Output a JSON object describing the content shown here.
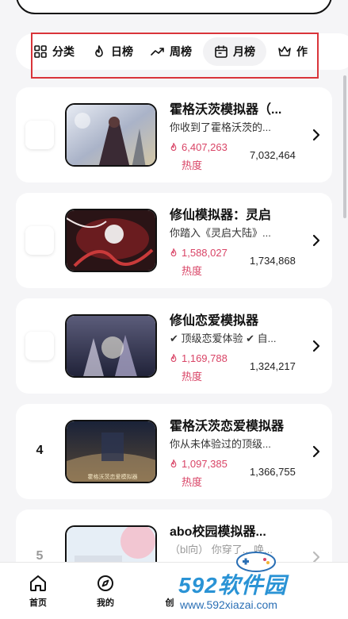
{
  "tabs": [
    {
      "label": "分类",
      "icon": "grid-icon"
    },
    {
      "label": "日榜",
      "icon": "flame-icon"
    },
    {
      "label": "周榜",
      "icon": "trend-icon"
    },
    {
      "label": "月榜",
      "icon": "calendar-icon",
      "active": true
    },
    {
      "label": "作",
      "icon": "crown-icon"
    }
  ],
  "heat_label": "热度",
  "items": [
    {
      "rank": "",
      "title": "霍格沃茨模拟器（...",
      "desc": "你收到了霍格沃茨的...",
      "heat": "6,407,263",
      "count": "7,032,464"
    },
    {
      "rank": "",
      "title": "修仙模拟器：灵启",
      "desc": "你踏入《灵启大陆》...",
      "heat": "1,588,027",
      "count": "1,734,868"
    },
    {
      "rank": "",
      "title": "修仙恋爱模拟器",
      "desc": "✔ 顶级恋爱体验 ✔ 自...",
      "heat": "1,169,788",
      "count": "1,324,217"
    },
    {
      "rank": "4",
      "title": "霍格沃茨恋爱模拟器",
      "desc": "你从未体验过的顶级...",
      "heat": "1,097,385",
      "count": "1,366,755"
    },
    {
      "rank": "5",
      "title": "abo校园模拟器...",
      "desc": "（bl向） 你穿了... 唤...",
      "heat": "",
      "count": ""
    }
  ],
  "thumb_caption": "霍格沃茨恋爱模拟器",
  "nav": [
    {
      "label": "首页",
      "icon": "home-icon"
    },
    {
      "label": "我的",
      "icon": "compass-icon"
    },
    {
      "label": "创",
      "icon": "create-icon"
    }
  ],
  "watermark": {
    "text": "592软件园",
    "url": "www.592xiazai.com"
  },
  "colors": {
    "accent": "#d94466",
    "annotation": "#d9343a",
    "watermark": "#2a93d5"
  }
}
